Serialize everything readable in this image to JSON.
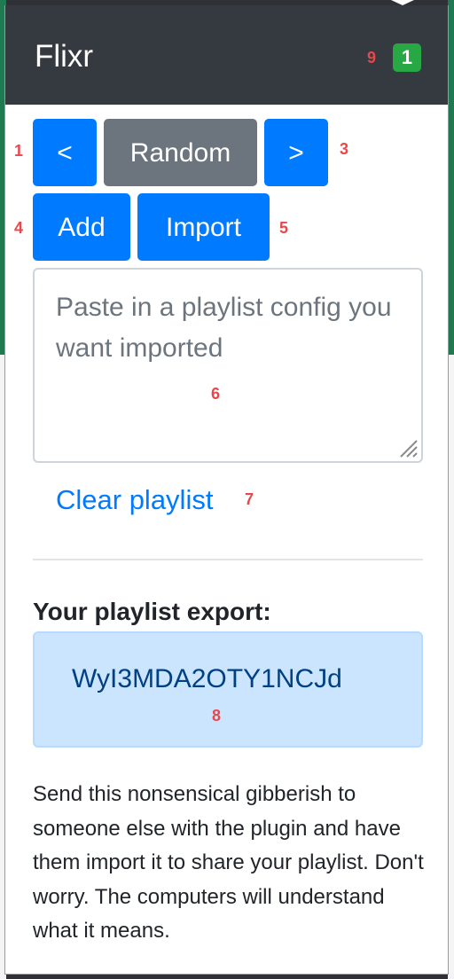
{
  "header": {
    "title": "Flixr",
    "badge_count": "1",
    "badge_color": "#28a745",
    "background_color": "#343a40"
  },
  "markers": {
    "prev": "1",
    "next": "3",
    "add": "4",
    "import": "5",
    "textarea": "6",
    "clear": "7",
    "export": "8",
    "badge": "9"
  },
  "controls": {
    "prev_label": "<",
    "random_label": "Random",
    "next_label": ">",
    "add_label": "Add",
    "import_label": "Import",
    "primary_color": "#007bff",
    "secondary_color": "#6c757d"
  },
  "import_field": {
    "value": "",
    "placeholder": "Paste in a playlist config you want imported"
  },
  "clear_link": "Clear playlist",
  "export": {
    "heading": "Your playlist export:",
    "code": "WyI3MDA2OTY1NCJd",
    "description": "Send this nonsensical gibberish to someone else with the plugin and have them import it to share your playlist. Don't worry. The computers will understand what it means."
  },
  "icons": {
    "resize": "resize-grip-icon"
  }
}
